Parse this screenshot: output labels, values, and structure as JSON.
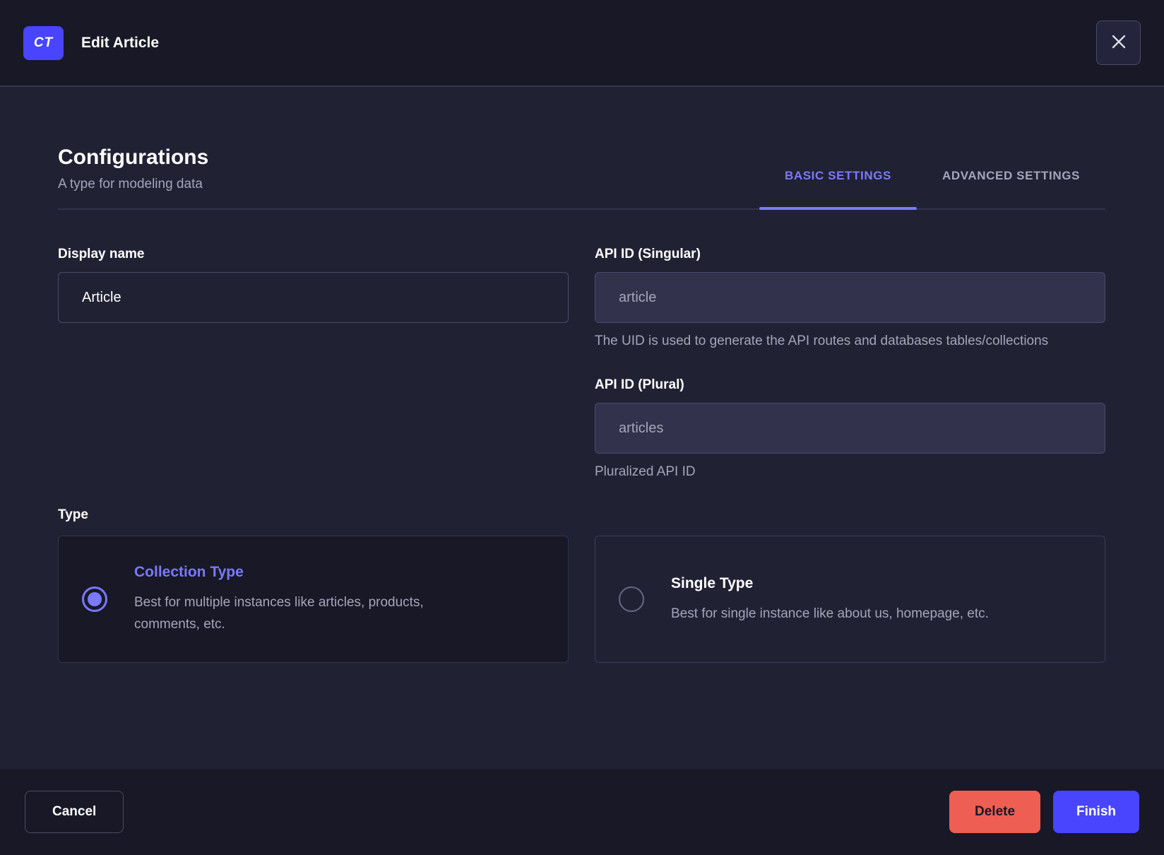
{
  "colors": {
    "primary": "#4945ff",
    "primary_light": "#7b79ff",
    "danger": "#ee5e52",
    "background": "#212134",
    "surface_dark": "#181826",
    "border": "#4a4a6a",
    "text_muted": "#a5a5ba"
  },
  "header": {
    "badge": "CT",
    "title": "Edit Article",
    "close_icon": "x-icon"
  },
  "section": {
    "title": "Configurations",
    "subtitle": "A type for modeling data"
  },
  "tabs": [
    {
      "label": "BASIC SETTINGS",
      "active": true
    },
    {
      "label": "ADVANCED SETTINGS",
      "active": false
    }
  ],
  "form": {
    "display_name": {
      "label": "Display name",
      "value": "Article"
    },
    "api_id_singular": {
      "label": "API ID (Singular)",
      "value": "article",
      "helper": "The UID is used to generate the API routes and databases tables/collections"
    },
    "api_id_plural": {
      "label": "API ID (Plural)",
      "value": "articles",
      "helper": "Pluralized API ID"
    },
    "type": {
      "label": "Type",
      "options": [
        {
          "title": "Collection Type",
          "description": "Best for multiple instances like articles, products, comments, etc.",
          "selected": true
        },
        {
          "title": "Single Type",
          "description": "Best for single instance like about us, homepage, etc.",
          "selected": false
        }
      ]
    }
  },
  "footer": {
    "cancel_label": "Cancel",
    "delete_label": "Delete",
    "finish_label": "Finish"
  }
}
